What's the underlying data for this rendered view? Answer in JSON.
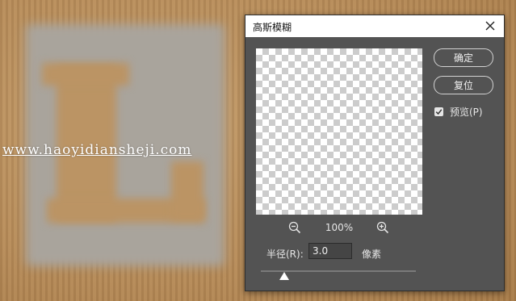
{
  "canvas": {
    "watermark": "www.haoyidiansheji.com"
  },
  "dialog": {
    "title": "高斯模糊",
    "zoom_level": "100%",
    "radius_label": "半径(R):",
    "radius_value": "3.0",
    "unit_label": "像素",
    "slider_position": 0.15,
    "ok_label": "确定",
    "reset_label": "复位",
    "preview_label": "预览(P)",
    "preview_checked": true
  },
  "icons": {
    "close": "close-icon",
    "zoom_out": "zoom-out-icon",
    "zoom_in": "zoom-in-icon",
    "check": "checkmark-icon"
  },
  "colors": {
    "dialog_bg": "#535353",
    "titlebar_bg": "#ffffff",
    "canvas_cardboard": "#b98c57"
  }
}
